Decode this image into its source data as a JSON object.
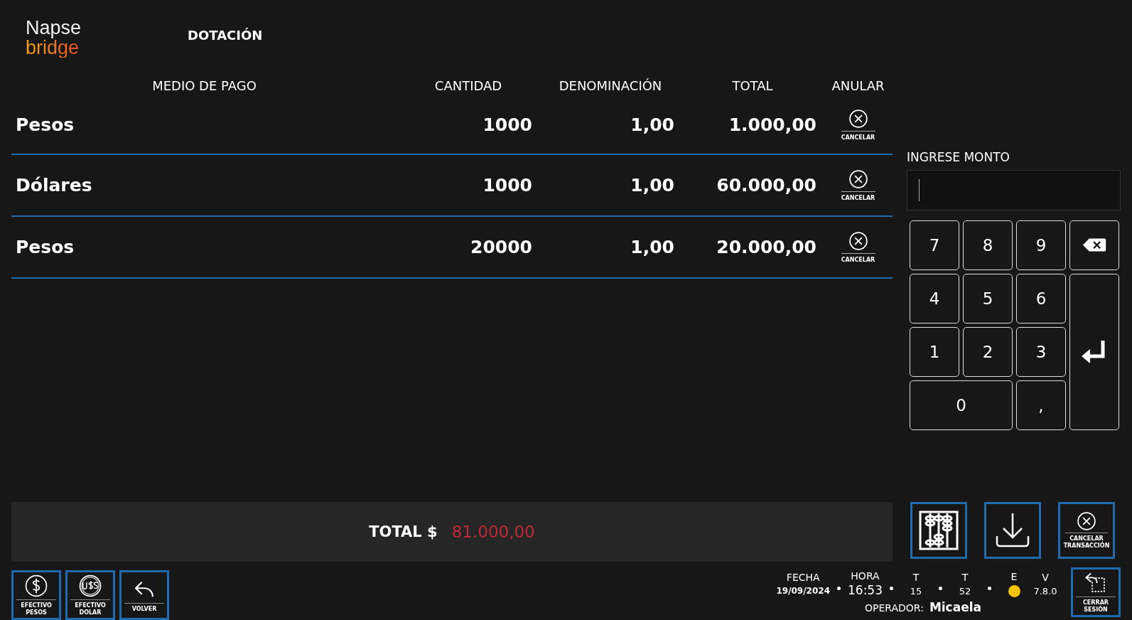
{
  "logo": {
    "line_1": "Napse",
    "line_2": "bridge"
  },
  "title": "DOTACIÓN",
  "table": {
    "columns": [
      "MEDIO DE PAGO",
      "CANTIDAD",
      "DENOMINACIÓN",
      "TOTAL",
      "ANULAR"
    ],
    "rows": [
      {
        "medio": "Pesos",
        "cantidad": "1000",
        "denominacion": "1,00",
        "total": "1.000,00",
        "action": "CANCELAR"
      },
      {
        "medio": "Dólares",
        "cantidad": "1000",
        "denominacion": "1,00",
        "total": "60.000,00",
        "action": "CANCELAR"
      },
      {
        "medio": "Pesos",
        "cantidad": "20000",
        "denominacion": "1,00",
        "total": "20.000,00",
        "action": "CANCELAR"
      }
    ]
  },
  "entry": {
    "label": "INGRESE MONTO"
  },
  "keypad": [
    {
      "kind": "digit",
      "label": "7"
    },
    {
      "kind": "digit",
      "label": "8"
    },
    {
      "kind": "digit",
      "label": "9"
    },
    {
      "kind": "backspace"
    },
    {
      "kind": "digit",
      "label": "4"
    },
    {
      "kind": "digit",
      "label": "5"
    },
    {
      "kind": "digit",
      "label": "6"
    },
    {
      "kind": "enter"
    },
    {
      "kind": "digit",
      "label": "1"
    },
    {
      "kind": "digit",
      "label": "2"
    },
    {
      "kind": "digit",
      "label": "3"
    },
    {
      "kind": "zero",
      "label": "0"
    },
    {
      "kind": "digit",
      "label": ","
    }
  ],
  "total": {
    "label": "TOTAL $",
    "value": "81.000,00"
  },
  "actions": [
    {
      "kind": "abacus"
    },
    {
      "kind": "download"
    },
    {
      "kind": "cancel",
      "label": "CANCELAR TRANSACCIÓN"
    }
  ],
  "bottom_buttons": [
    {
      "kind": "pesos",
      "label": "EFECTIVO PESOS"
    },
    {
      "kind": "dollar",
      "label": "EFECTIVO DOLAR"
    },
    {
      "kind": "back",
      "label": "VOLVER"
    }
  ],
  "status": [
    {
      "kind": "text",
      "label": "FECHA",
      "value": "19/09/2024"
    },
    {
      "kind": "time",
      "label": "HORA",
      "value": "16:53"
    },
    {
      "kind": "text",
      "label": "T",
      "value": "15"
    },
    {
      "kind": "text",
      "label": "T",
      "value": "52"
    },
    {
      "kind": "dot",
      "label": "E",
      "color": "#f5c400"
    },
    {
      "kind": "text",
      "label": "V",
      "value": "7.8.0"
    }
  ],
  "operator": {
    "label": "OPERADOR:",
    "value": "Micaela"
  },
  "logout": {
    "label": "CERRAR SESIÓN"
  }
}
